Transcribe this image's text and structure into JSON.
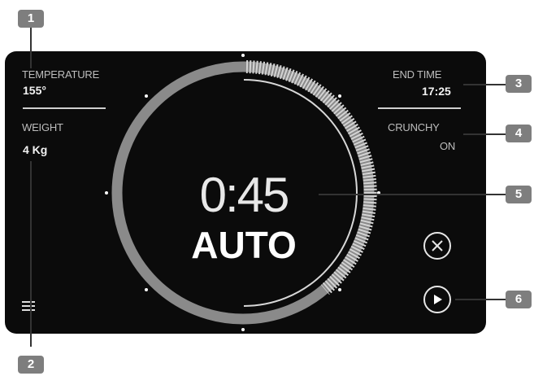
{
  "callouts": [
    "1",
    "2",
    "3",
    "4",
    "5",
    "6"
  ],
  "temperature": {
    "label": "TEMPERATURE",
    "value": "155°"
  },
  "weight": {
    "label": "WEIGHT",
    "value": "4 Kg"
  },
  "end_time": {
    "label": "END TIME",
    "value": "17:25"
  },
  "crunchy": {
    "label": "CRUNCHY",
    "value": "ON"
  },
  "timer": {
    "value": "0:45",
    "mode": "AUTO"
  },
  "controls": {
    "menu_icon": "menu-icon",
    "cancel_icon": "close-icon",
    "start_icon": "play-icon"
  },
  "colors": {
    "screen": "#0b0b0b",
    "ring": "#8a8a8a",
    "badge": "#7e7e7e"
  }
}
